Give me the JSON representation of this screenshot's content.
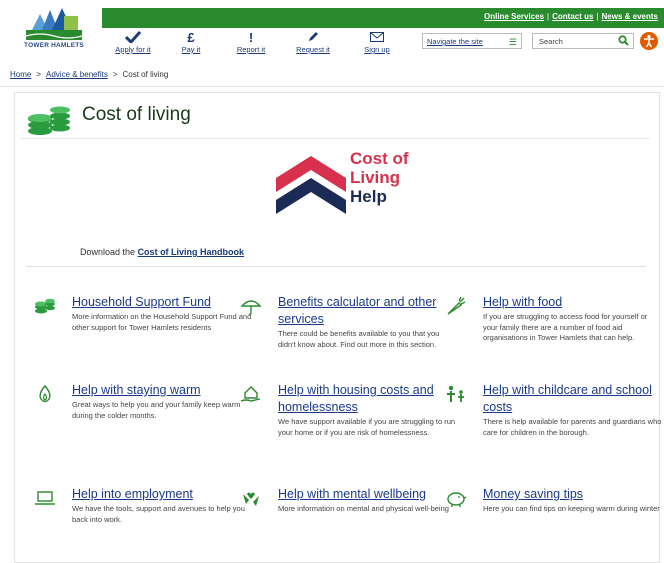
{
  "header": {
    "logo_text": "TOWER HAMLETS",
    "top_links": [
      "Online Services",
      "Contact us",
      "News & events"
    ],
    "nav": [
      {
        "label": "Apply for it",
        "icon": "checkmark-icon"
      },
      {
        "label": "Pay it",
        "icon": "pound-icon"
      },
      {
        "label": "Report it",
        "icon": "exclamation-icon"
      },
      {
        "label": "Request it",
        "icon": "pencil-icon"
      },
      {
        "label": "Sign up",
        "icon": "envelope-icon"
      }
    ],
    "navigate_label": "Navigate the site",
    "search_placeholder": "Search",
    "accessibility_icon": "accessibility-icon",
    "colors": {
      "green": "#2a8a2e",
      "navy": "#1b3a7a",
      "orange": "#e05a00"
    }
  },
  "breadcrumb": {
    "home": "Home",
    "section": "Advice & benefits",
    "current": "Cost of living"
  },
  "page": {
    "title": "Cost of living",
    "title_icon": "coins-icon",
    "logo_lines": [
      "Cost of",
      "Living",
      "Help"
    ],
    "download_prefix": "Download the",
    "download_link": "Cost of Living Handbook"
  },
  "cards": [
    {
      "title": "Household Support Fund",
      "text": "More information on the Household Support Fund and other support for Tower Hamlets residents",
      "icon": "coins-icon"
    },
    {
      "title": "Benefits calculator and other services",
      "text": "There could be benefits available to you that you didn't know about. Find out more in this section.",
      "icon": "umbrella-icon"
    },
    {
      "title": "Help with food",
      "text": "If you are struggling to access food for yourself or your family there are a number of food aid organisations in Tower Hamlets that can help.",
      "icon": "carrot-icon"
    },
    {
      "title": "Help with staying warm",
      "text": "Great ways to help you and your family keep warm during the colder months.",
      "icon": "flame-icon"
    },
    {
      "title": "Help with housing costs and homelessness",
      "text": "We have support available if you are struggling to run your home or if you are risk of homelessness.",
      "icon": "house-hand-icon"
    },
    {
      "title": "Help with childcare and school costs",
      "text": "There is help available for parents and guardians who care for children in the borough.",
      "icon": "family-icon"
    },
    {
      "title": "Help into employment",
      "text": "We have the tools, support and avenues to help you back into work.",
      "icon": "laptop-icon"
    },
    {
      "title": "Help with mental wellbeing",
      "text": "More information on mental and physical well-being",
      "icon": "heart-hands-icon"
    },
    {
      "title": "Money saving tips",
      "text": "Here you can find tips on keeping warm during winter",
      "icon": "piggy-bank-icon"
    }
  ]
}
